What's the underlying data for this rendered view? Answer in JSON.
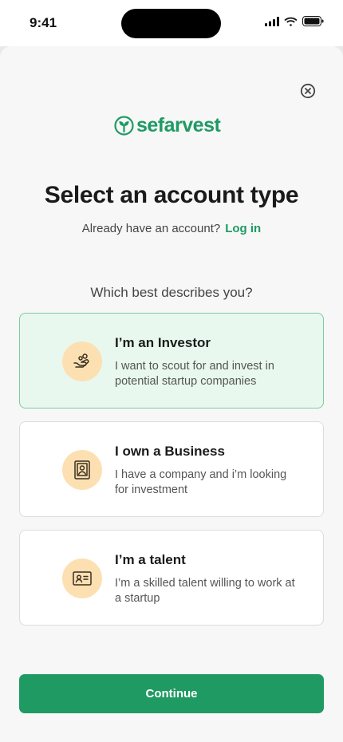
{
  "status_bar": {
    "time": "9:41"
  },
  "brand": {
    "name": "sefarvest",
    "color": "#1f9a63"
  },
  "header": {
    "title": "Select an account type",
    "login_prompt": "Already have an account?",
    "login_link": "Log in"
  },
  "question": "Which best describes you?",
  "options": [
    {
      "title": "I’m an Investor",
      "description": "I want to scout for and invest in potential startup companies",
      "icon": "hand-coins-icon",
      "selected": true
    },
    {
      "title": "I own a Business",
      "description": "I have a company and i’m looking for investment",
      "icon": "portrait-icon",
      "selected": false
    },
    {
      "title": "I’m a talent",
      "description": "I’m a skilled talent willing to work at a startup",
      "icon": "id-card-icon",
      "selected": false
    }
  ],
  "continue_label": "Continue",
  "colors": {
    "accent": "#1f9a63",
    "selected_bg": "#e8f8ee",
    "icon_bg": "#fde0b2"
  }
}
